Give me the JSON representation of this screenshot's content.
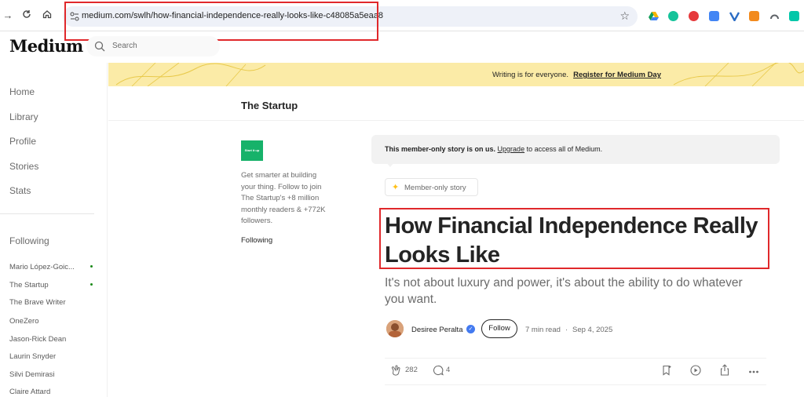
{
  "browser": {
    "url": "medium.com/swlh/how-financial-independence-really-looks-like-c48085a5eaa8",
    "extensions": [
      {
        "name": "google-drive-icon",
        "color": "#f4b400"
      },
      {
        "name": "grammarly-icon",
        "color": "#15c39a"
      },
      {
        "name": "adblock-plus-icon",
        "color": "#e6393c"
      },
      {
        "name": "extension-blue-icon",
        "color": "#4285f4"
      },
      {
        "name": "vpn-icon",
        "color": "#2a6cc4"
      },
      {
        "name": "extension-orange-icon",
        "color": "#f28a1d"
      },
      {
        "name": "extension-gray-icon",
        "color": "#5f6368"
      },
      {
        "name": "extension-teal-icon",
        "color": "#00c7a9"
      }
    ]
  },
  "header": {
    "logo": "Medium",
    "search_placeholder": "Search"
  },
  "sidebar": {
    "nav": [
      "Home",
      "Library",
      "Profile",
      "Stories",
      "Stats"
    ],
    "following_heading": "Following",
    "following": [
      {
        "label": "Mario López-Goic...",
        "dot": true
      },
      {
        "label": "The Startup",
        "dot": true
      },
      {
        "label": "The Brave Writer",
        "dot": false
      },
      {
        "label": "OneZero",
        "dot": false
      },
      {
        "label": "Jason-Rick Dean",
        "dot": false
      },
      {
        "label": "Laurin Snyder",
        "dot": false
      },
      {
        "label": "Silvi Demirasi",
        "dot": false
      },
      {
        "label": "Claire Attard",
        "dot": false
      }
    ]
  },
  "banner": {
    "text": "Writing is for everyone.",
    "link": "Register for Medium Day",
    "color": "#fbeba7"
  },
  "publication": {
    "title": "The Startup",
    "logo_text": "Start it up",
    "description": "Get smarter at building your thing. Follow to join The Startup's +8 million monthly readers & +772K followers.",
    "follow_label": "Following"
  },
  "article": {
    "member_notice_bold": "This member-only story is on us.",
    "member_notice_link": "Upgrade",
    "member_notice_rest": "to access all of Medium.",
    "badge": "Member-only story",
    "title": "How Financial Independence Really Looks Like",
    "subtitle": "It's not about luxury and power, it's about the ability to do whatever you want.",
    "author": "Desiree Peralta",
    "follow_button": "Follow",
    "read_time": "7 min read",
    "separator": "·",
    "date": "Sep 4, 2025",
    "claps": "282",
    "responses": "4"
  }
}
